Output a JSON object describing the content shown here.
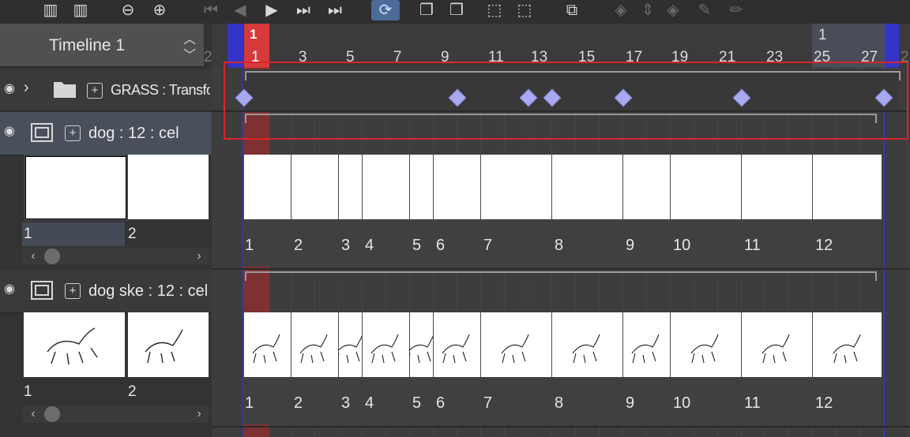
{
  "toolbar": {
    "buttons": [
      {
        "name": "new-timeline-icon",
        "glyph": "▥",
        "state": "normal"
      },
      {
        "name": "add-layer-icon",
        "glyph": "▥",
        "state": "normal"
      },
      {
        "name": "zoom-out-icon",
        "glyph": "⊖",
        "state": "normal"
      },
      {
        "name": "zoom-in-icon",
        "glyph": "⊕",
        "state": "normal"
      },
      {
        "name": "first-frame-icon",
        "glyph": "⏮",
        "state": "dim"
      },
      {
        "name": "previous-frame-icon",
        "glyph": "◀",
        "state": "dim"
      },
      {
        "name": "play-icon",
        "glyph": "▶",
        "state": "normal"
      },
      {
        "name": "next-frame-icon",
        "glyph": "⏭",
        "state": "normal"
      },
      {
        "name": "last-frame-icon",
        "glyph": "⏭",
        "state": "normal"
      },
      {
        "name": "loop-icon",
        "glyph": "⟳",
        "state": "active"
      },
      {
        "name": "new-cel-icon",
        "glyph": "❐",
        "state": "normal"
      },
      {
        "name": "add-cel-icon",
        "glyph": "❐",
        "state": "normal"
      },
      {
        "name": "specify-cel-icon",
        "glyph": "⬚",
        "state": "normal"
      },
      {
        "name": "delete-cel-icon",
        "glyph": "⬚",
        "state": "normal"
      },
      {
        "name": "onion-skin-icon",
        "glyph": "⧉",
        "state": "normal"
      },
      {
        "name": "keyframe-icon",
        "glyph": "◈",
        "state": "dim"
      },
      {
        "name": "keyframe-chevron-icon",
        "glyph": "⇕",
        "state": "dim"
      },
      {
        "name": "delete-keyframe-icon",
        "glyph": "◈",
        "state": "dim"
      },
      {
        "name": "edit-icon",
        "glyph": "✎",
        "state": "dim"
      },
      {
        "name": "pencil-icon",
        "glyph": "✏",
        "state": "dim"
      }
    ]
  },
  "timeline": {
    "name": "Timeline 1",
    "current_frame": "1",
    "end_marker": "1",
    "ruler_numbers": [
      "2",
      "1",
      "3",
      "5",
      "7",
      "9",
      "11",
      "13",
      "15",
      "17",
      "19",
      "21",
      "23",
      "25",
      "27",
      "2"
    ]
  },
  "layers": [
    {
      "label": "GRASS : Transform",
      "type": "folder"
    },
    {
      "label": "dog : 12 : cel",
      "type": "animation-folder",
      "thumb_numbers": [
        "1",
        "2"
      ],
      "cel_numbers": [
        "1",
        "2",
        "3",
        "4",
        "5",
        "6",
        "7",
        "8",
        "9",
        "10",
        "11",
        "12"
      ]
    },
    {
      "label": "dog ske : 12 : cel",
      "type": "animation-folder",
      "thumb_numbers": [
        "1",
        "2"
      ],
      "cel_numbers": [
        "1",
        "2",
        "3",
        "4",
        "5",
        "6",
        "7",
        "8",
        "9",
        "10",
        "11",
        "12"
      ]
    }
  ],
  "keyframes_at_frames": [
    1,
    10,
    13,
    14,
    17,
    22,
    28
  ],
  "colors": {
    "playhead": "#d63a3a",
    "range_marker": "#3434c8",
    "keyframe": "#a7a9f2",
    "selection": "#d9252a"
  }
}
